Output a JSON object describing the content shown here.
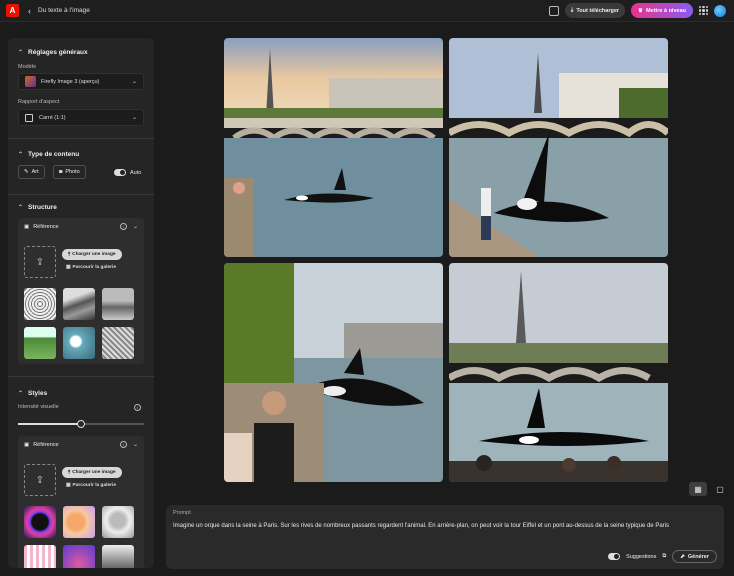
{
  "header": {
    "app_icon": "adobe-logo",
    "title": "Du texte à l'image",
    "download_label": "Tout télécharger",
    "upgrade_label": "Mettre à niveau"
  },
  "sidebar": {
    "general": {
      "heading": "Réglages généraux",
      "model_label": "Modèle",
      "model_value": "Firefly Image 3 (aperçu)",
      "ratio_label": "Rapport d'aspect",
      "ratio_value": "Carré (1:1)"
    },
    "content_type": {
      "heading": "Type de contenu",
      "art_label": "Art",
      "photo_label": "Photo",
      "auto_label": "Auto"
    },
    "structure": {
      "heading": "Structure",
      "reference_label": "Référence",
      "upload_label": "Charger une image",
      "browse_label": "Parcourir la galerie"
    },
    "styles": {
      "heading": "Styles",
      "intensity_label": "Intensité visuelle",
      "intensity_level": 0.5,
      "reference_label": "Référence",
      "upload_label": "Charger une image",
      "browse_label": "Parcourir la galerie"
    }
  },
  "prompt": {
    "label": "Prompt",
    "text": "Imagine un orque dans la seine à Paris. Sur les rives de nombreux passants regardent l'animal. En arrière-plan, on peut voir la tour Eiffel et un pont au-dessus de la seine typique de Paris",
    "suggestions_label": "Suggestions",
    "generate_label": "Générer"
  },
  "colors": {
    "accent_gradient_start": "#e9338a",
    "accent_gradient_end": "#8b5bf3",
    "brand_red": "#eb1000"
  }
}
